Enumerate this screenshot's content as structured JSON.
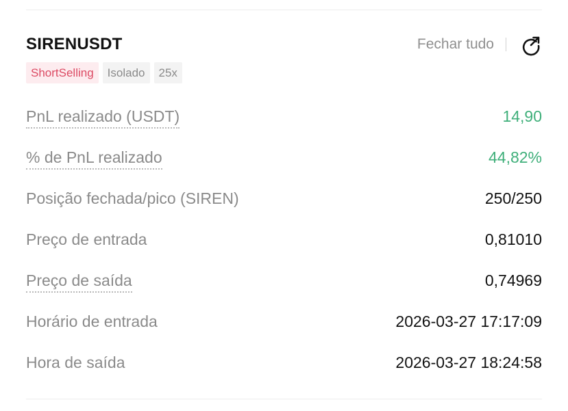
{
  "header": {
    "symbol": "SIRENUSDT",
    "close_all_label": "Fechar tudo",
    "share_icon": "share-arrow-icon"
  },
  "tags": [
    {
      "label": "ShortSelling",
      "color": "#dc4a63"
    },
    {
      "label": "Isolado"
    },
    {
      "label": "25x"
    }
  ],
  "rows": [
    {
      "label": "PnL realizado (USDT)",
      "value": "14,90"
    },
    {
      "label": "% de PnL realizado",
      "value": "44,82%"
    },
    {
      "label": "Posição fechada/pico (SIREN)",
      "value": "250/250"
    },
    {
      "label": "Preço de entrada",
      "value": "0,81010"
    },
    {
      "label": "Preço de saída",
      "value": "0,74969"
    },
    {
      "label": "Horário de entrada",
      "value": "2026-03-27 17:17:09"
    },
    {
      "label": "Hora de saída",
      "value": "2026-03-27 18:24:58"
    }
  ],
  "colors": {
    "positive": "#3faf7a",
    "short": "#dc4a63"
  }
}
